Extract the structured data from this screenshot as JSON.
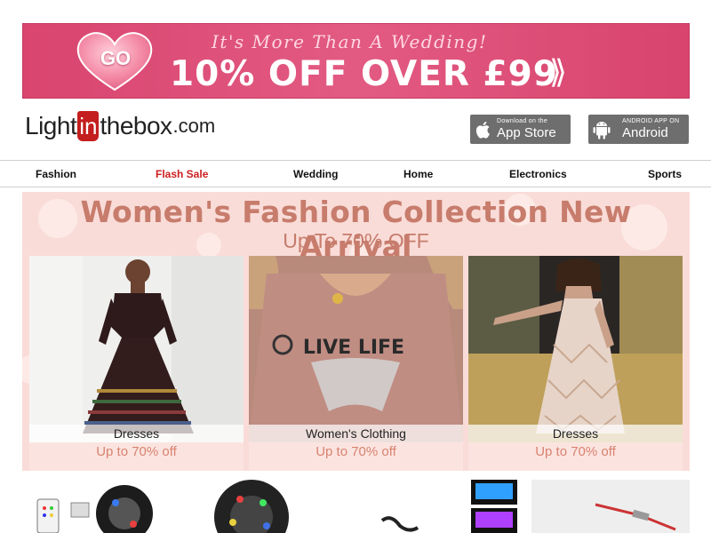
{
  "promo": {
    "tagline": "It's More Than A Wedding!",
    "headline": "10% OFF OVER £99",
    "go_label": "GO",
    "arrow": "⟫"
  },
  "header": {
    "logo": {
      "part1": "Light",
      "part2": "in",
      "part3": "thebox",
      "part4": ".com"
    },
    "app_store": {
      "small": "Download on the",
      "big": "App Store"
    },
    "android": {
      "small": "ANDROID APP ON",
      "big": "Android"
    }
  },
  "nav": {
    "items": [
      "Fashion",
      "Flash Sale",
      "Wedding",
      "Home",
      "Electronics",
      "Sports"
    ]
  },
  "hero": {
    "title": "Women's Fashion Collection New Arrival",
    "subtitle": "Up To 70% OFF",
    "cards": [
      {
        "label": "Dresses",
        "offer": "Up to 70% off"
      },
      {
        "label": "Women's Clothing",
        "offer": "Up to 70% off"
      },
      {
        "label": "Dresses",
        "offer": "Up to 70% off"
      }
    ],
    "shirt_text": "LIVE LIFE"
  },
  "colors": {
    "promo_pink": "#d9456f",
    "flash_sale": "#cc1f1f",
    "hero_text": "#c77c6c",
    "offer_text": "#d9826f",
    "store_button": "#6e6e6e"
  }
}
